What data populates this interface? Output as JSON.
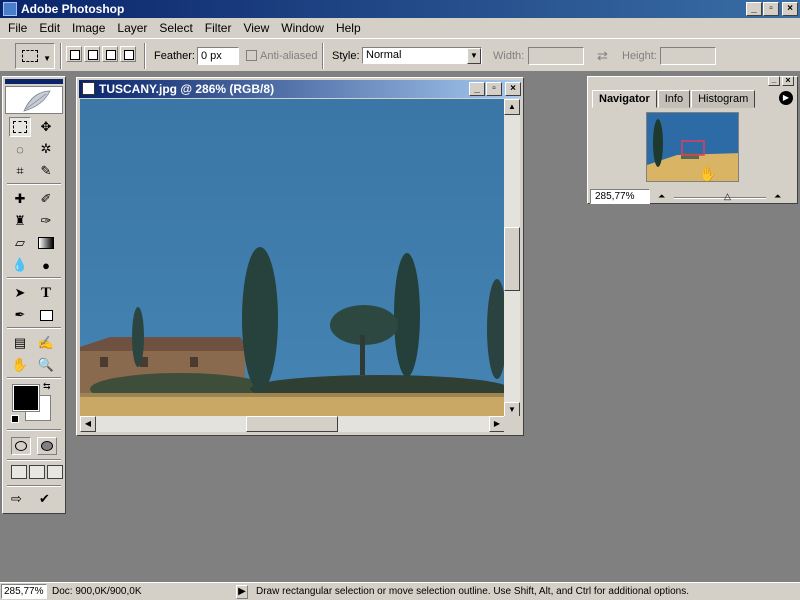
{
  "app": {
    "title": "Adobe Photoshop"
  },
  "window_controls": {
    "minimize": "_",
    "maximize": "▫",
    "close": "×"
  },
  "menu": [
    "File",
    "Edit",
    "Image",
    "Layer",
    "Select",
    "Filter",
    "View",
    "Window",
    "Help"
  ],
  "options_bar": {
    "feather_label": "Feather:",
    "feather_value": "0 px",
    "anti_aliased_label": "Anti-aliased",
    "style_label": "Style:",
    "style_value": "Normal",
    "width_label": "Width:",
    "width_value": "",
    "height_label": "Height:",
    "height_value": ""
  },
  "document": {
    "title": "TUSCANY.jpg @ 286% (RGB/8)"
  },
  "navigator": {
    "tabs": [
      "Navigator",
      "Info",
      "Histogram"
    ],
    "active_tab": "Navigator",
    "zoom": "285,77%"
  },
  "status": {
    "zoom": "285,77%",
    "doc_info": "Doc: 900,0K/900,0K",
    "hint": "Draw rectangular selection or move selection outline.  Use Shift, Alt, and Ctrl for additional options."
  },
  "colors": {
    "foreground": "#000000",
    "background": "#ffffff",
    "sky": "#3d79a8",
    "ground": "#c9a866",
    "accent": "#0a246a"
  },
  "icons": [
    "marquee-icon",
    "move-icon",
    "lasso-icon",
    "magic-wand-icon",
    "crop-icon",
    "slice-icon",
    "healing-brush-icon",
    "brush-icon",
    "clone-stamp-icon",
    "history-brush-icon",
    "eraser-icon",
    "gradient-icon",
    "blur-icon",
    "dodge-icon",
    "path-selection-icon",
    "type-icon",
    "pen-icon",
    "shape-icon",
    "notes-icon",
    "eyedropper-icon",
    "hand-icon",
    "zoom-icon"
  ]
}
